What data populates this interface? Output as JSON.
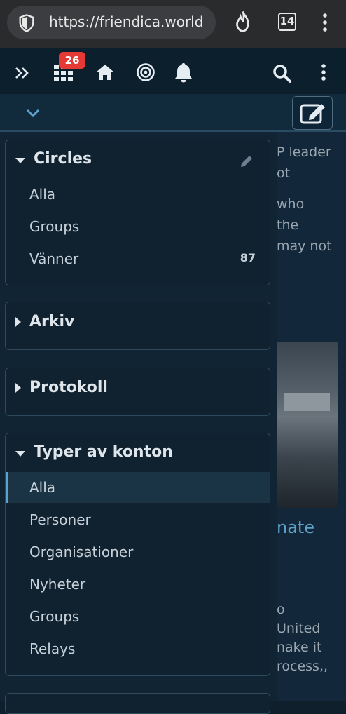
{
  "browser": {
    "url": "https://friendica.world",
    "tab_count": "14"
  },
  "nav": {
    "notification_count": "26"
  },
  "background": {
    "lines": [
      "P leader",
      "ot",
      "who",
      "the",
      "may not",
      "o",
      "United",
      "nake it",
      "rocess,,"
    ],
    "link_fragment": "nate"
  },
  "sidebar": {
    "circles": {
      "title": "Circles",
      "items": [
        {
          "label": "Alla",
          "count": ""
        },
        {
          "label": "Groups",
          "count": ""
        },
        {
          "label": "Vänner",
          "count": "87"
        }
      ]
    },
    "arkiv": {
      "title": "Arkiv"
    },
    "protokoll": {
      "title": "Protokoll"
    },
    "account_types": {
      "title": "Typer av konton",
      "items": [
        "Alla",
        "Personer",
        "Organisationer",
        "Nyheter",
        "Groups",
        "Relays"
      ],
      "active_index": 0
    }
  },
  "colors": {
    "accent": "#5ba2cf",
    "badge": "#e53935",
    "panel": "#10212f",
    "nav": "#0b1f2d"
  }
}
